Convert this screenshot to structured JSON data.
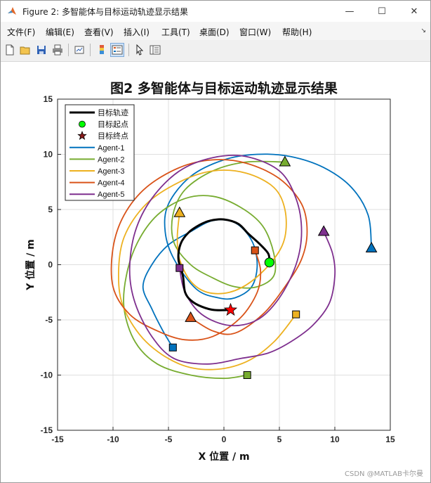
{
  "window": {
    "title": "Figure 2: 多智能体与目标运动轨迹显示结果",
    "controls": [
      "—",
      "☐",
      "✕"
    ]
  },
  "menu": [
    "文件(F)",
    "编辑(E)",
    "查看(V)",
    "插入(I)",
    "工具(T)",
    "桌面(D)",
    "窗口(W)",
    "帮助(H)"
  ],
  "watermark": "CSDN @MATLAB卡尔曼",
  "chart_data": {
    "type": "line",
    "title": "图2 多智能体与目标运动轨迹显示结果",
    "xlabel": "X 位置 / m",
    "ylabel": "Y 位置 / m",
    "xlim": [
      -15,
      15
    ],
    "ylim": [
      -15,
      15
    ],
    "xticks": [
      -15,
      -10,
      -5,
      0,
      5,
      10,
      15
    ],
    "yticks": [
      -15,
      -10,
      -5,
      0,
      5,
      10,
      15
    ],
    "grid": true,
    "legend_position": "top-left",
    "legend": [
      "目标轨迹",
      "目标起点",
      "目标终点",
      "Agent-1",
      "Agent-2",
      "Agent-3",
      "Agent-4",
      "Agent-5"
    ],
    "target": {
      "name": "目标轨迹",
      "color": "#000000",
      "start_label": "目标起点",
      "end_label": "目标终点",
      "start_color": "#00ff00",
      "end_color": "#ff0000",
      "points": [
        [
          4.1,
          0.2
        ],
        [
          4.0,
          1.0
        ],
        [
          3.2,
          1.9
        ],
        [
          2.2,
          2.8
        ],
        [
          1.3,
          3.7
        ],
        [
          0.0,
          4.1
        ],
        [
          -1.2,
          4.0
        ],
        [
          -2.2,
          3.6
        ],
        [
          -3.2,
          2.9
        ],
        [
          -3.9,
          1.9
        ],
        [
          -4.1,
          0.5
        ],
        [
          -3.7,
          -1.0
        ],
        [
          -3.5,
          -2.5
        ],
        [
          -2.9,
          -3.3
        ],
        [
          -2.0,
          -3.8
        ],
        [
          -0.9,
          -4.1
        ],
        [
          0.6,
          -4.1
        ]
      ]
    },
    "series": [
      {
        "name": "Agent-1",
        "color": "#0072BD",
        "start_marker": "square",
        "end_marker": "triangle",
        "points": [
          [
            -4.6,
            -7.5
          ],
          [
            -5.5,
            -6.0
          ],
          [
            -6.5,
            -4.0
          ],
          [
            -7.3,
            -2.0
          ],
          [
            -6.5,
            0.0
          ],
          [
            -5.0,
            1.8
          ],
          [
            -3.0,
            3.0
          ],
          [
            -1.0,
            4.0
          ],
          [
            1.0,
            3.8
          ],
          [
            2.5,
            2.2
          ],
          [
            3.0,
            0.0
          ],
          [
            2.5,
            -2.0
          ],
          [
            1.0,
            -3.0
          ],
          [
            -0.5,
            -3.0
          ],
          [
            -2.5,
            -2.2
          ],
          [
            -4.5,
            0.5
          ],
          [
            -5.3,
            3.0
          ],
          [
            -5.0,
            5.5
          ],
          [
            -3.0,
            8.0
          ],
          [
            0.0,
            9.5
          ],
          [
            3.0,
            10.0
          ],
          [
            6.0,
            9.8
          ],
          [
            9.0,
            8.8
          ],
          [
            11.5,
            7.0
          ],
          [
            13.0,
            4.5
          ],
          [
            13.3,
            1.5
          ]
        ]
      },
      {
        "name": "Agent-2",
        "color": "#77AC30",
        "start_marker": "square",
        "end_marker": "triangle",
        "points": [
          [
            2.1,
            -10.0
          ],
          [
            0.0,
            -10.3
          ],
          [
            -3.0,
            -10.0
          ],
          [
            -6.0,
            -9.0
          ],
          [
            -8.0,
            -7.0
          ],
          [
            -9.0,
            -4.0
          ],
          [
            -8.8,
            -1.0
          ],
          [
            -7.8,
            2.0
          ],
          [
            -6.0,
            4.5
          ],
          [
            -3.5,
            6.0
          ],
          [
            -1.0,
            6.2
          ],
          [
            1.5,
            5.2
          ],
          [
            3.5,
            3.5
          ],
          [
            4.5,
            1.0
          ],
          [
            4.5,
            -1.0
          ],
          [
            3.0,
            -2.0
          ],
          [
            1.0,
            -2.0
          ],
          [
            -1.0,
            -1.2
          ],
          [
            -3.0,
            0.0
          ],
          [
            -4.5,
            2.0
          ],
          [
            -4.6,
            4.5
          ],
          [
            -3.5,
            6.8
          ],
          [
            -1.0,
            8.5
          ],
          [
            2.0,
            9.3
          ],
          [
            5.5,
            9.3
          ]
        ]
      },
      {
        "name": "Agent-3",
        "color": "#EDB120",
        "start_marker": "square",
        "end_marker": "triangle",
        "points": [
          [
            6.5,
            -4.5
          ],
          [
            4.5,
            -7.0
          ],
          [
            2.0,
            -8.8
          ],
          [
            -1.0,
            -9.5
          ],
          [
            -4.0,
            -9.0
          ],
          [
            -7.0,
            -7.0
          ],
          [
            -9.0,
            -4.0
          ],
          [
            -9.5,
            -1.0
          ],
          [
            -9.0,
            2.5
          ],
          [
            -7.0,
            5.5
          ],
          [
            -4.0,
            7.5
          ],
          [
            -1.0,
            8.5
          ],
          [
            2.0,
            8.3
          ],
          [
            4.5,
            7.0
          ],
          [
            5.5,
            5.0
          ],
          [
            5.5,
            2.5
          ],
          [
            4.5,
            0.5
          ],
          [
            2.5,
            -1.5
          ],
          [
            0.5,
            -2.5
          ],
          [
            -1.5,
            -2.5
          ],
          [
            -3.0,
            -1.5
          ],
          [
            -4.0,
            0.5
          ],
          [
            -4.2,
            2.5
          ],
          [
            -4.0,
            4.7
          ]
        ]
      },
      {
        "name": "Agent-4",
        "color": "#D95319",
        "start_marker": "square",
        "end_marker": "triangle",
        "points": [
          [
            2.8,
            1.3
          ],
          [
            3.3,
            -0.5
          ],
          [
            3.0,
            -2.5
          ],
          [
            1.5,
            -4.8
          ],
          [
            -1.0,
            -6.5
          ],
          [
            -3.5,
            -6.8
          ],
          [
            -6.0,
            -6.0
          ],
          [
            -8.5,
            -4.5
          ],
          [
            -10.0,
            -2.0
          ],
          [
            -10.0,
            1.5
          ],
          [
            -9.0,
            4.5
          ],
          [
            -7.0,
            7.0
          ],
          [
            -4.0,
            8.8
          ],
          [
            -1.0,
            9.5
          ],
          [
            2.0,
            9.2
          ],
          [
            5.0,
            7.8
          ],
          [
            7.0,
            5.5
          ],
          [
            7.5,
            3.0
          ],
          [
            7.0,
            0.5
          ],
          [
            5.5,
            -2.0
          ],
          [
            3.5,
            -4.5
          ],
          [
            1.0,
            -6.2
          ],
          [
            -1.0,
            -6.0
          ],
          [
            -3.0,
            -4.8
          ]
        ]
      },
      {
        "name": "Agent-5",
        "color": "#7E2F8E",
        "start_marker": "square",
        "end_marker": "triangle",
        "points": [
          [
            -4.0,
            -0.3
          ],
          [
            -3.5,
            -2.5
          ],
          [
            -2.0,
            -4.5
          ],
          [
            0.5,
            -5.5
          ],
          [
            3.0,
            -5.0
          ],
          [
            5.0,
            -3.0
          ],
          [
            6.5,
            0.0
          ],
          [
            7.0,
            3.0
          ],
          [
            6.5,
            6.0
          ],
          [
            5.0,
            8.5
          ],
          [
            2.0,
            9.8
          ],
          [
            -1.0,
            9.7
          ],
          [
            -4.0,
            8.5
          ],
          [
            -6.5,
            6.0
          ],
          [
            -8.0,
            3.0
          ],
          [
            -8.5,
            -0.5
          ],
          [
            -8.0,
            -3.5
          ],
          [
            -6.5,
            -6.5
          ],
          [
            -4.5,
            -8.5
          ],
          [
            -1.5,
            -9.0
          ],
          [
            1.5,
            -8.5
          ],
          [
            4.0,
            -8.0
          ],
          [
            6.0,
            -7.0
          ],
          [
            8.0,
            -5.5
          ],
          [
            9.5,
            -3.5
          ],
          [
            10.0,
            -1.0
          ],
          [
            9.8,
            1.0
          ],
          [
            9.0,
            3.0
          ]
        ]
      }
    ]
  }
}
